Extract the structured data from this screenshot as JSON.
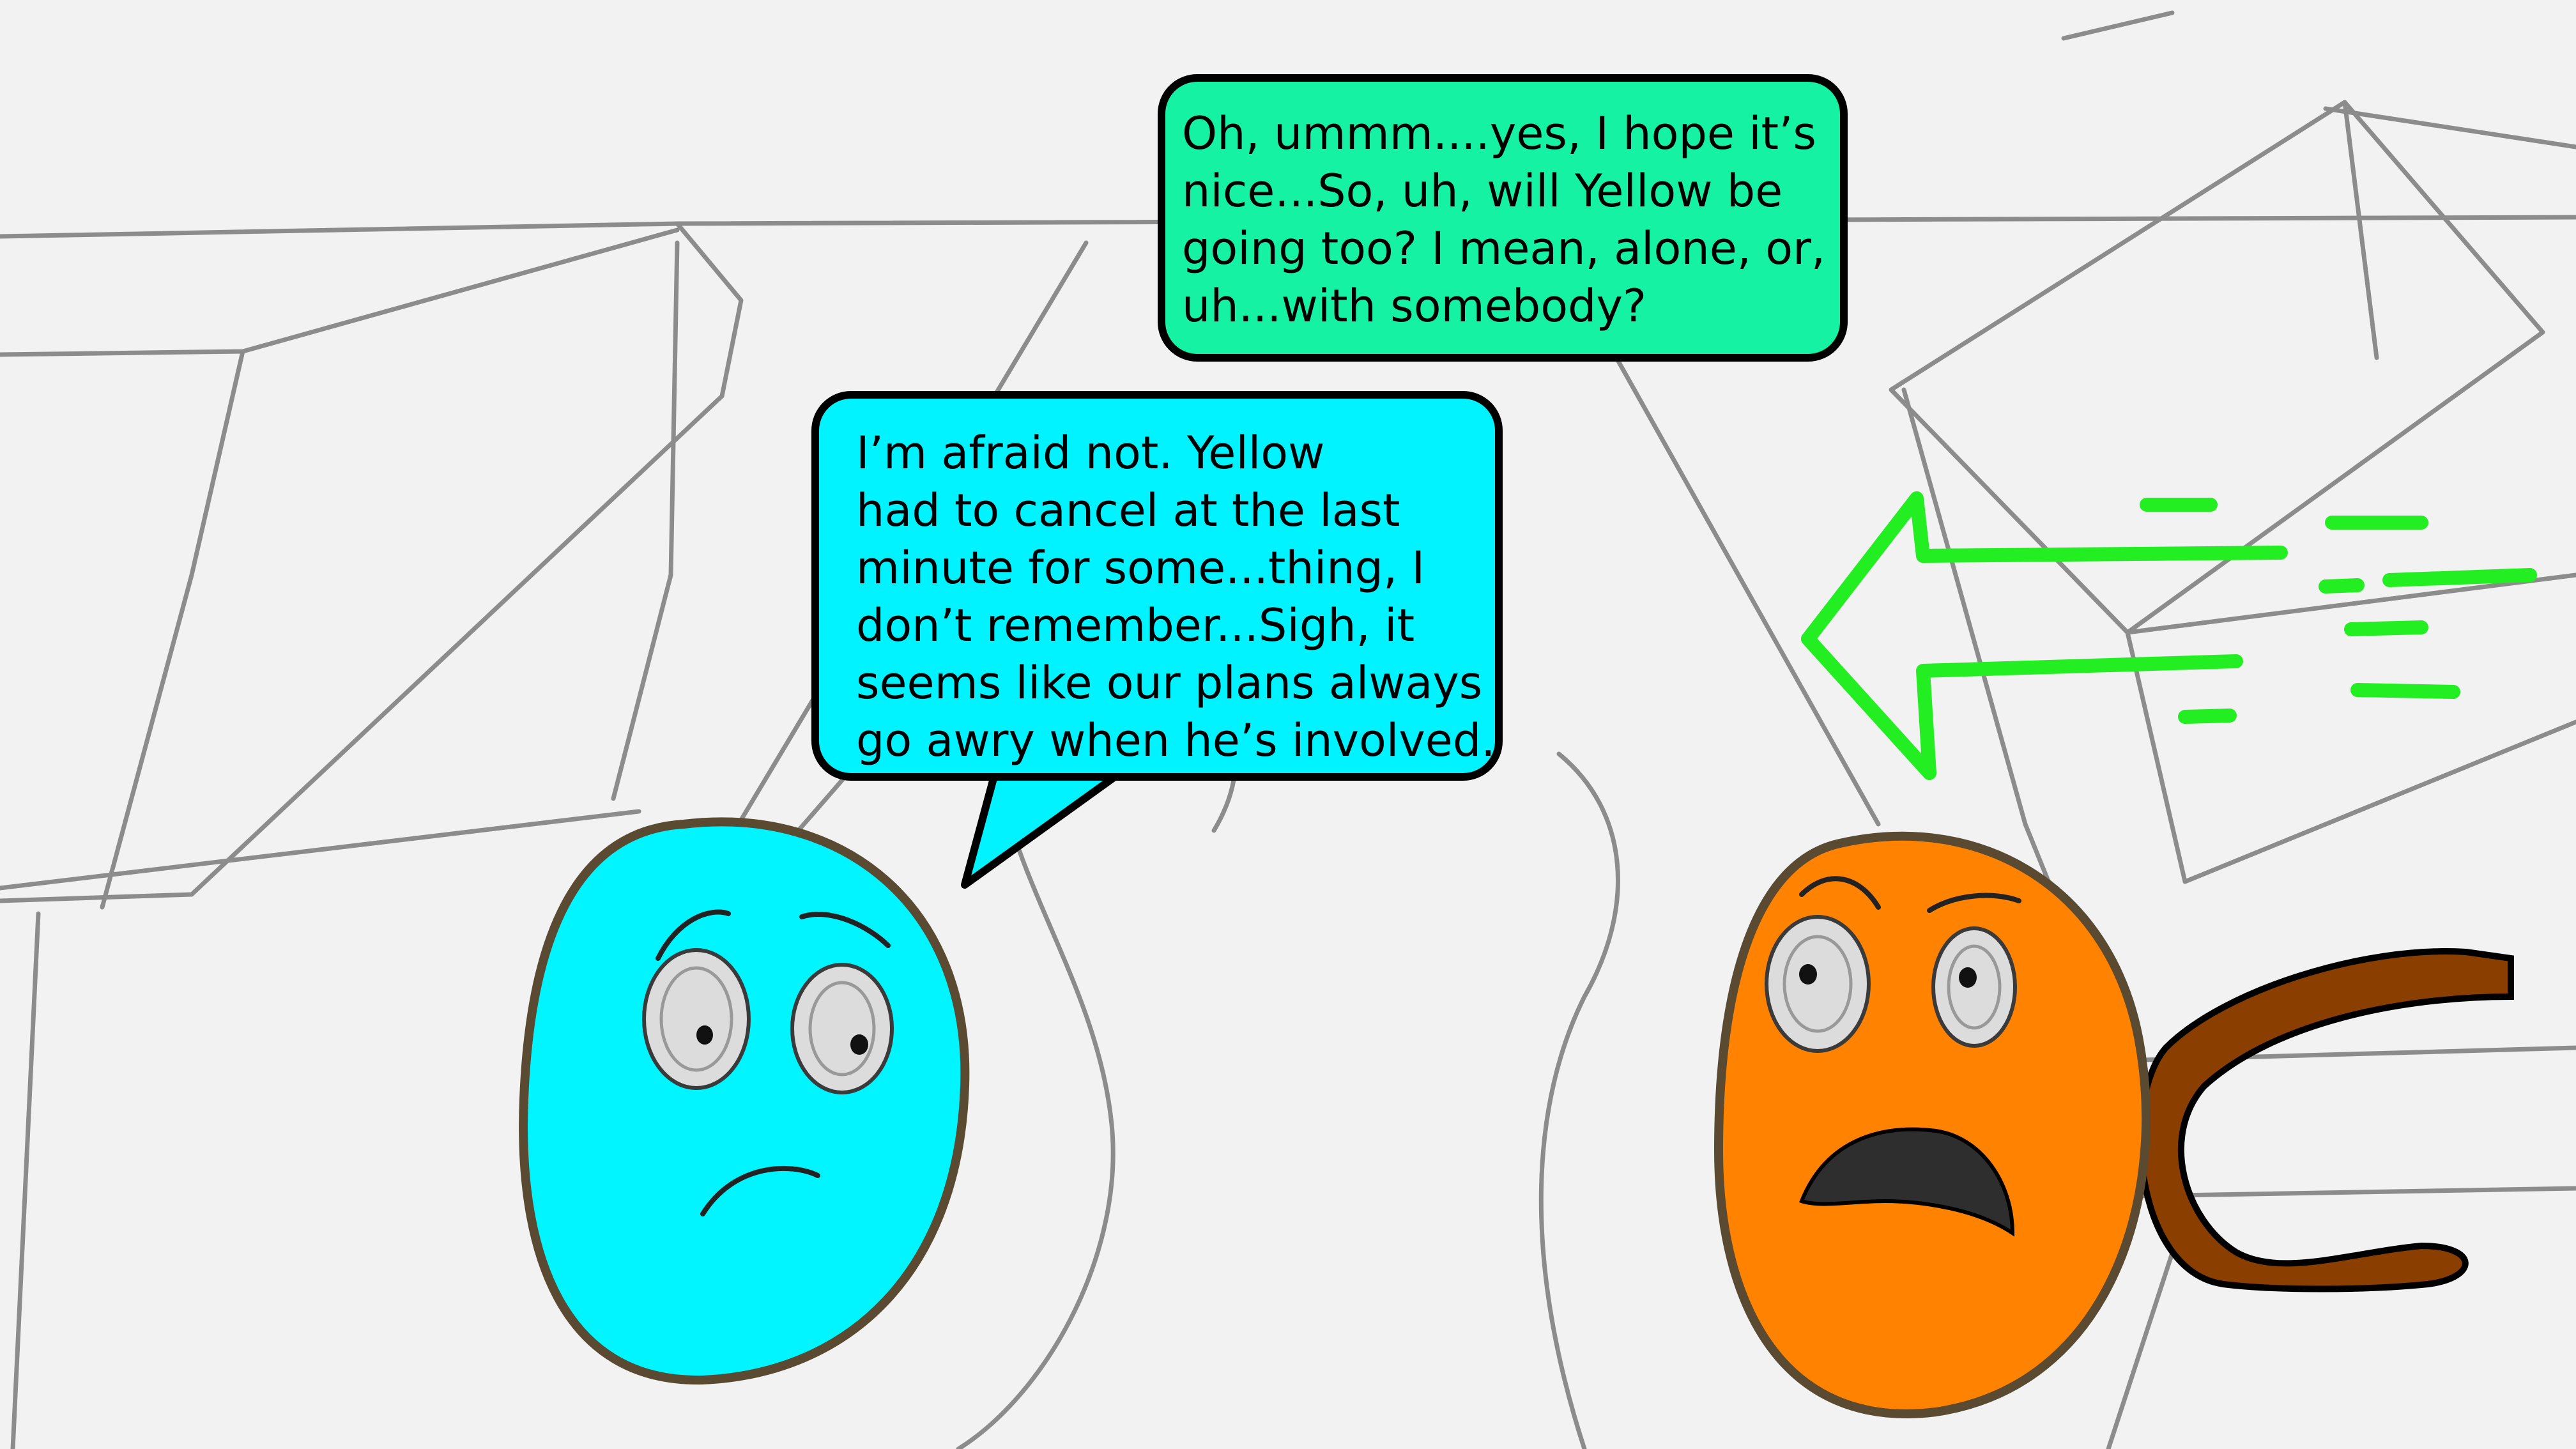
{
  "dialogue": {
    "green_speaker_bubble": {
      "lines": [
        "Oh, ummm....yes, I hope it’s",
        "nice...So, uh, will Yellow be",
        "going too? I mean, alone, or,",
        "uh...with somebody?"
      ]
    },
    "cyan_character_bubble": {
      "lines": [
        "I’m afraid not. Yellow",
        "had to cancel at the last",
        "minute for some...thing, I",
        "don’t remember...Sigh, it",
        "seems like our plans always",
        "go awry when he’s involved."
      ]
    }
  },
  "characters": {
    "cyan_character": {
      "color": "#00f5ff",
      "expression": "worried-sad"
    },
    "orange_character": {
      "color": "#ff8200",
      "expression": "startled"
    }
  },
  "off_panel_arrow": {
    "color": "#22ee22",
    "direction": "pointing-left"
  },
  "colors": {
    "background": "#f2f2f2",
    "sketch_lines": "#8a8a8a",
    "outline": "#5a4a32",
    "tail": "#8a3e00"
  }
}
